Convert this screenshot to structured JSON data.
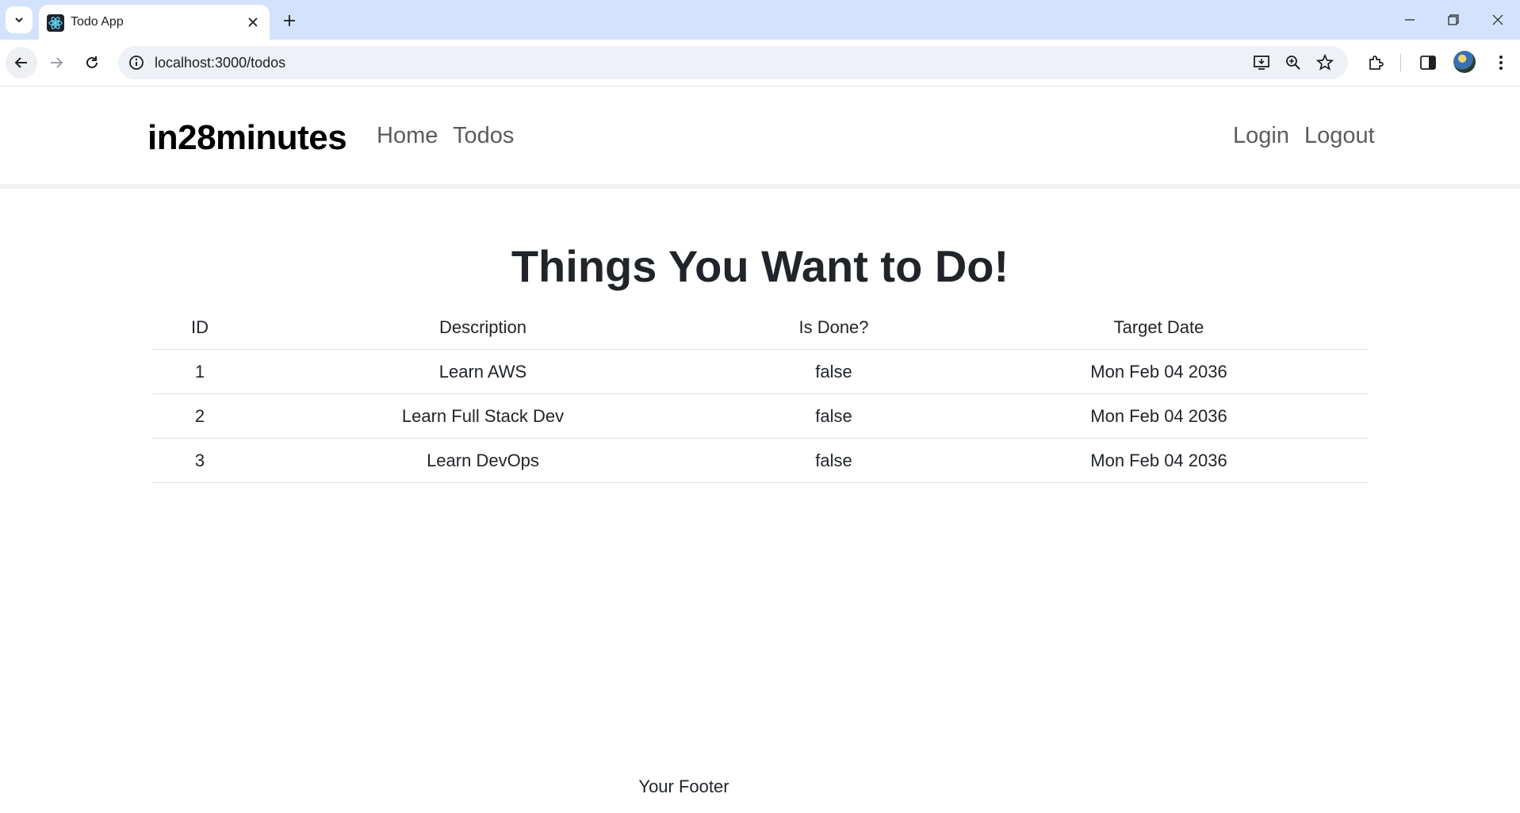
{
  "browser": {
    "tab_title": "Todo App",
    "url": "localhost:3000/todos"
  },
  "app": {
    "brand": "in28minutes",
    "nav": {
      "home": "Home",
      "todos": "Todos",
      "login": "Login",
      "logout": "Logout"
    },
    "title": "Things You Want to Do!",
    "table": {
      "headers": [
        "ID",
        "Description",
        "Is Done?",
        "Target Date"
      ],
      "rows": [
        {
          "id": "1",
          "description": "Learn AWS",
          "done": "false",
          "target": "Mon Feb 04 2036"
        },
        {
          "id": "2",
          "description": "Learn Full Stack Dev",
          "done": "false",
          "target": "Mon Feb 04 2036"
        },
        {
          "id": "3",
          "description": "Learn DevOps",
          "done": "false",
          "target": "Mon Feb 04 2036"
        }
      ]
    },
    "footer": "Your Footer"
  },
  "colors": {
    "tabstrip": "#d3e3fd",
    "omnibox": "#eef1f6",
    "nav_link": "#595c5f",
    "text": "#212529"
  }
}
